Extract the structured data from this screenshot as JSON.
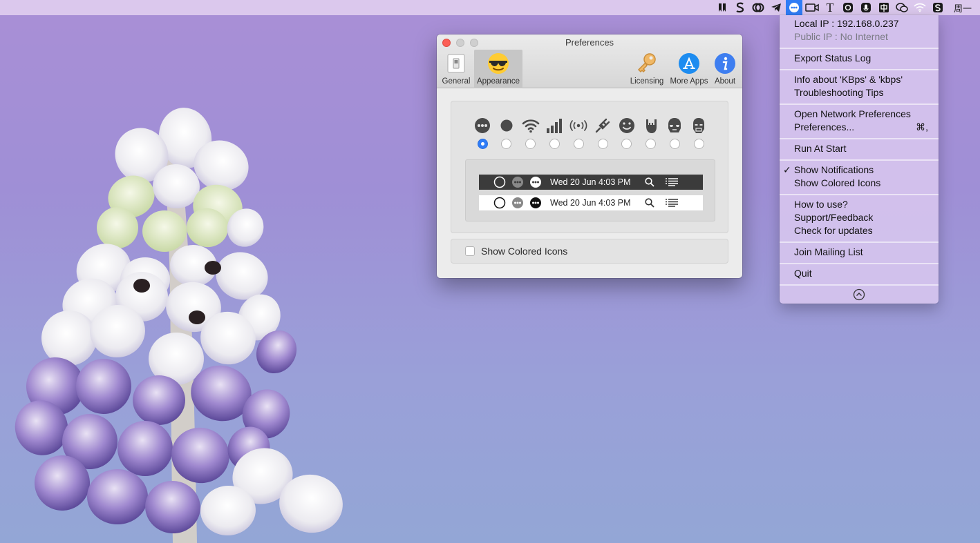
{
  "menubar": {
    "icons": [
      "bookmark-icon",
      "scrivener-s-icon",
      "creative-cloud-icon",
      "telegram-icon",
      "network-status-icon",
      "facetime-icon",
      "text-t-icon",
      "camera-app-icon",
      "microphone-app-icon",
      "input-method-icon",
      "wechat-icon",
      "wifi-icon",
      "scrivener-app-icon"
    ],
    "clock": "周一"
  },
  "preferences": {
    "title": "Preferences",
    "toolbar": {
      "general": "General",
      "appearance": "Appearance",
      "licensing": "Licensing",
      "more_apps": "More Apps",
      "about": "About"
    },
    "icon_styles": [
      "dots-face",
      "solid-circle",
      "wifi",
      "signal-bars",
      "broadcast",
      "plug",
      "smiley",
      "rock-hand",
      "stormtrooper",
      "iron-man"
    ],
    "selected_style_index": 0,
    "preview": {
      "dark_time": "Wed 20 Jun  4:03 PM",
      "light_time": "Wed 20 Jun  4:03 PM"
    },
    "show_colored_icons_label": "Show Colored Icons",
    "show_colored_icons_checked": false
  },
  "dropdown": {
    "local_ip": "Local IP   : 192.168.0.237",
    "public_ip": "Public IP : No Internet",
    "export_log": "Export Status Log",
    "info_kbps": "Info about 'KBps' & 'kbps'",
    "troubleshooting": "Troubleshooting Tips",
    "open_network": "Open Network Preferences",
    "preferences": "Preferences...",
    "preferences_shortcut": "⌘,",
    "run_at_start": "Run At Start",
    "show_notifications": "Show Notifications",
    "show_notifications_checked": "✓",
    "show_colored_icons": "Show Colored Icons",
    "how_to_use": "How to use?",
    "support": "Support/Feedback",
    "check_updates": "Check for updates",
    "mailing_list": "Join Mailing List",
    "quit": "Quit"
  },
  "colors": {
    "accent": "#2f7cf6",
    "close_button": "#fc5f57",
    "menu_bg": "#d6c4ee"
  }
}
